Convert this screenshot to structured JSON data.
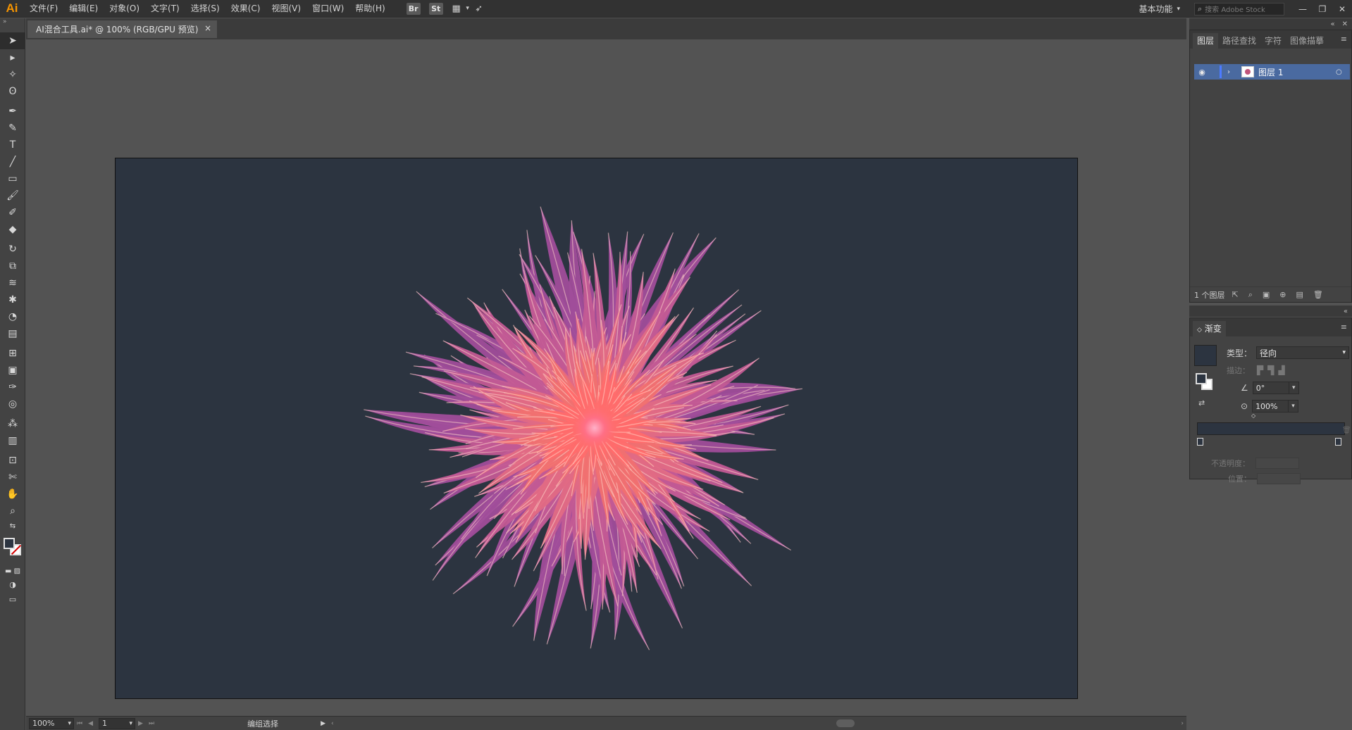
{
  "app": {
    "logo": "Ai"
  },
  "menu": [
    "文件(F)",
    "编辑(E)",
    "对象(O)",
    "文字(T)",
    "选择(S)",
    "效果(C)",
    "视图(V)",
    "窗口(W)",
    "帮助(H)"
  ],
  "menubar_buttons": {
    "bridge": "Br",
    "stock": "St"
  },
  "workspace": {
    "label": "基本功能"
  },
  "stock_search": {
    "placeholder": "搜索 Adobe Stock"
  },
  "document_tab": {
    "title": "AI混合工具.ai* @ 100% (RGB/GPU 预览)",
    "close": "×"
  },
  "layers_panel": {
    "tabs": [
      "图层",
      "路径查找",
      "字符",
      "图像描摹"
    ],
    "active_tab": "图层",
    "layer": {
      "name": "图层 1"
    },
    "footer_count": "1 个图层"
  },
  "gradient_panel": {
    "title": "渐变",
    "type_label": "类型：",
    "type_value": "径向",
    "stroke_label": "描边：",
    "angle_value": "0°",
    "aspect_value": "100%",
    "opacity_label": "不透明度：",
    "location_label": "位置："
  },
  "statusbar": {
    "zoom": "100%",
    "artboard_number": "1",
    "status_text": "编组选择"
  },
  "colors": {
    "artboard_bg": "#2c3440",
    "flower_center": "#ff6b6b",
    "flower_mid": "#f07070",
    "flower_outer": "#a04d9a",
    "flower_tip": "#ffd6c8",
    "selected_layer": "#4a6aa0",
    "ai_orange": "#f79500"
  },
  "icons": {
    "toolbar": [
      "selection-icon",
      "direct-selection-icon",
      "magic-wand-icon",
      "lasso-icon",
      "pen-icon",
      "curvature-icon",
      "type-icon",
      "line-icon",
      "rectangle-icon",
      "paintbrush-icon",
      "shaper-icon",
      "eraser-icon",
      "rotate-icon",
      "scale-icon",
      "warp-icon",
      "puppet-warp-icon",
      "shape-builder-icon",
      "perspective-icon",
      "mesh-icon",
      "gradient-icon",
      "eyedropper-icon",
      "blend-icon",
      "symbol-sprayer-icon",
      "graph-icon",
      "artboard-icon",
      "slice-icon",
      "hand-icon",
      "zoom-icon"
    ]
  }
}
